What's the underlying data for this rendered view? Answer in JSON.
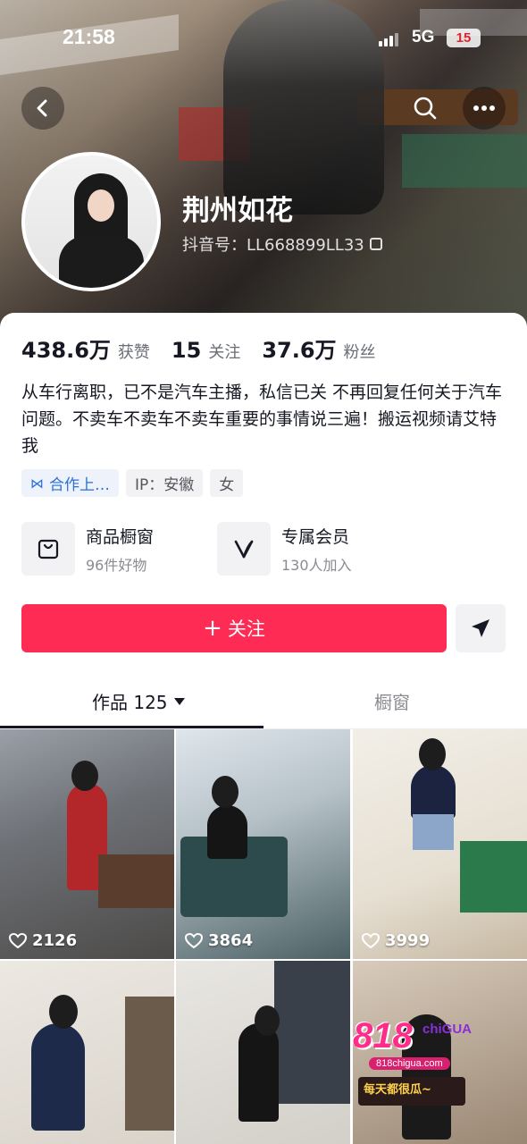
{
  "status_bar": {
    "time": "21:58",
    "network": "5G",
    "battery": "15"
  },
  "profile": {
    "nickname": "荆州如花",
    "douyin_id": "抖音号：LL668899LL33"
  },
  "stats": [
    {
      "value": "438.6万",
      "label": "获赞"
    },
    {
      "value": "15",
      "label": "关注"
    },
    {
      "value": "37.6万",
      "label": "粉丝"
    }
  ],
  "bio": "从车行离职，已不是汽车主播，私信已关 不再回复任何关于汽车问题。不卖车不卖车不卖车重要的事情说三遍！搬运视频请艾特我",
  "tags": {
    "cooperation": "合作上…",
    "ip": "IP：安徽",
    "gender": "女"
  },
  "services": [
    {
      "title": "商品橱窗",
      "sub": "96件好物",
      "icon": "bag-icon"
    },
    {
      "title": "专属会员",
      "sub": "130人加入",
      "icon": "v-icon"
    }
  ],
  "actions": {
    "follow_label": "关注",
    "follow_prefix": "+"
  },
  "tabs": {
    "works": "作品 125",
    "shop": "橱窗"
  },
  "videos": [
    {
      "likes": "2126"
    },
    {
      "likes": "3864"
    },
    {
      "likes": "3999"
    },
    {
      "likes": ""
    },
    {
      "likes": ""
    },
    {
      "likes": ""
    }
  ],
  "ad": {
    "num": "818",
    "brand": "chiGUA",
    "domain": "818chigua.com",
    "slogan": "每天都很瓜~"
  },
  "colors": {
    "accent": "#fe2c55",
    "link_blue": "#2b6fd6"
  }
}
